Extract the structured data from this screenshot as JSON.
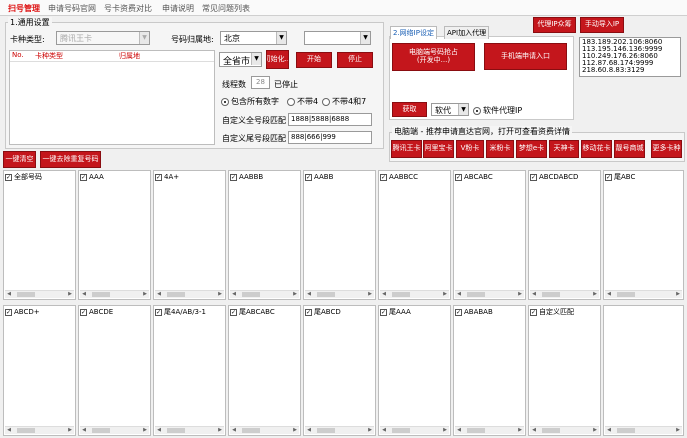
{
  "top_tabs": [
    {
      "label": "扫号管理"
    },
    {
      "label": "申请号码官网"
    },
    {
      "label": "号卡资费对比"
    },
    {
      "label": "申请说明"
    },
    {
      "label": "常见问题列表"
    }
  ],
  "general": {
    "title": "1.通用设置",
    "card_type_label": "卡种类型:",
    "card_type_value": "腾讯王卡",
    "region_label": "号码归属地:",
    "province": "北京",
    "city": "",
    "list_headers": [
      "No.",
      "卡种类型",
      "归属地"
    ],
    "scope": "全省市",
    "init_btn": "初始化...",
    "start_btn": "开始",
    "stop_btn": "停止",
    "threads_label": "线程数",
    "threads_value": "28",
    "stopped": "已停止",
    "radio_all": "包含所有数字",
    "radio_no4": "不带4",
    "radio_no47": "不带4和7",
    "custom_all_label": "自定义全号段匹配",
    "custom_all_value": "1888|5888|6888",
    "custom_tail_label": "自定义尾号段匹配",
    "custom_tail_value": "888|666|999"
  },
  "network": {
    "tab_ip": "2.网络IP设定",
    "tab_api": "API加入代理",
    "pc_btn_l1": "电脑端号码抢占",
    "pc_btn_l2": "(开发中...)",
    "mobile_btn": "手机端申请入口",
    "proxy_btn": "代理IP众筹",
    "import_btn": "手动导入IP",
    "ips": "183.189.202.106:8060\n113.195.146.136:9999\n110.249.176.26:8060\n112.87.68.174:9999\n218.60.8.83:3129",
    "fetch_btn": "获取",
    "soft_value": "软代",
    "soft_radio": "软件代理IP"
  },
  "recommend": {
    "title": "电脑端 - 推荐申请直达官网，打开可查看资费详情",
    "buttons": [
      "腾讯王卡",
      "阿里宝卡",
      "V粉卡",
      "米粉卡",
      "梦想e卡",
      "天神卡",
      "移动花卡",
      "靓号商城",
      "更多卡种"
    ]
  },
  "actions": {
    "clear_btn": "一键清空",
    "dedupe_btn": "一键去除重复号码"
  },
  "panels_row1": [
    {
      "label": "全部号码"
    },
    {
      "label": "AAA"
    },
    {
      "label": "4A+"
    },
    {
      "label": "AABBB"
    },
    {
      "label": "AABB"
    },
    {
      "label": "AABBCC"
    },
    {
      "label": "ABCABC"
    },
    {
      "label": "ABCDABCD"
    },
    {
      "label": "尾ABC"
    }
  ],
  "panels_row2": [
    {
      "label": "ABCD+"
    },
    {
      "label": "ABCDE"
    },
    {
      "label": "尾4A/AB/3-1"
    },
    {
      "label": "尾ABCABC"
    },
    {
      "label": "尾ABCD"
    },
    {
      "label": "尾AAA"
    },
    {
      "label": "ABABAB"
    },
    {
      "label": "自定义匹配"
    },
    {
      "label": ""
    }
  ]
}
